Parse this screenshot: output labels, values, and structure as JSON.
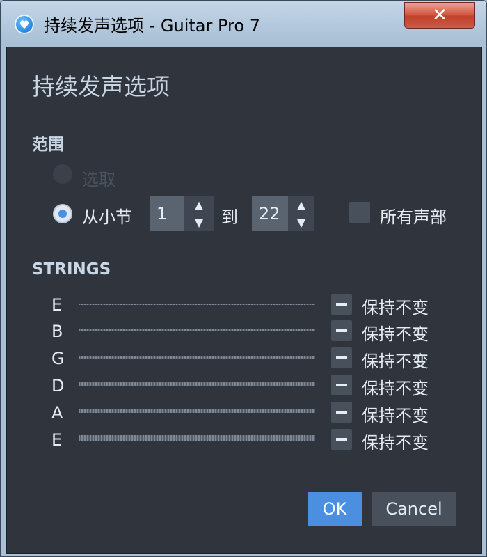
{
  "window": {
    "title": "持续发声选项 - Guitar Pro 7",
    "close_label": "✕"
  },
  "dialog": {
    "heading": "持续发声选项",
    "range_label": "范围",
    "option_selection": "选取",
    "option_from_bar": "从小节",
    "from_value": "1",
    "to_label": "到",
    "to_value": "22",
    "all_voices_label": "所有声部",
    "strings_label": "STRINGS",
    "strings": [
      {
        "name": "E",
        "mode": "保持不变"
      },
      {
        "name": "B",
        "mode": "保持不变"
      },
      {
        "name": "G",
        "mode": "保持不变"
      },
      {
        "name": "D",
        "mode": "保持不变"
      },
      {
        "name": "A",
        "mode": "保持不变"
      },
      {
        "name": "E",
        "mode": "保持不变"
      }
    ],
    "ok_label": "OK",
    "cancel_label": "Cancel"
  },
  "icons": {
    "spin_up": "▲",
    "spin_down": "▼"
  },
  "colors": {
    "accent": "#4a8fe0",
    "panel_bg": "#30353d",
    "control_bg": "#48505c"
  }
}
